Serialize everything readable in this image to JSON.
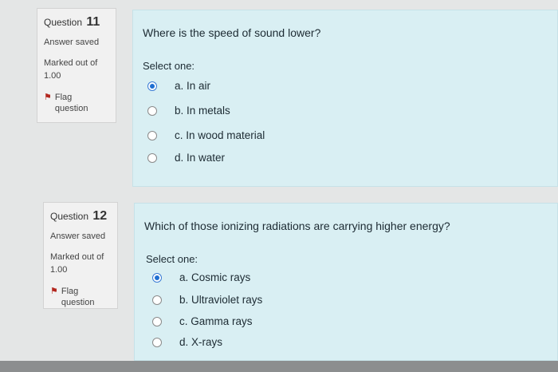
{
  "questions": [
    {
      "number_label": "Question",
      "number": "11",
      "state": "Answer saved",
      "grade_line1": "Marked out of",
      "grade_line2": "1.00",
      "flag_line1": "Flag",
      "flag_line2": "question",
      "prompt": "Where is the speed of sound lower?",
      "select_label": "Select one:",
      "answers": [
        {
          "label": "a. In air",
          "checked": true
        },
        {
          "label": "b. In metals",
          "checked": false
        },
        {
          "label": "c. In wood material",
          "checked": false
        },
        {
          "label": "d. In water",
          "checked": false
        }
      ]
    },
    {
      "number_label": "Question",
      "number": "12",
      "state": "Answer saved",
      "grade_line1": "Marked out of",
      "grade_line2": "1.00",
      "flag_line1": "Flag",
      "flag_line2": "question",
      "prompt": "Which of those ionizing radiations are carrying higher energy?",
      "select_label": "Select one:",
      "answers": [
        {
          "label": "a. Cosmic rays",
          "checked": true
        },
        {
          "label": "b. Ultraviolet rays",
          "checked": false
        },
        {
          "label": "c. Gamma rays",
          "checked": false
        },
        {
          "label": "d. X-rays",
          "checked": false
        }
      ]
    }
  ],
  "icons": {
    "flag": "flag-icon",
    "radio": "radio-button"
  }
}
